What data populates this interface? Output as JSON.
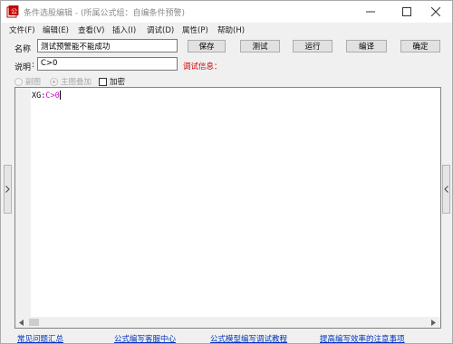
{
  "window": {
    "title": "条件选股编辑 - (所属公式组：自编条件预警)"
  },
  "menu": [
    {
      "label": "文件(F)"
    },
    {
      "label": "编辑(E)"
    },
    {
      "label": "查看(V)"
    },
    {
      "label": "插入(I)"
    },
    {
      "label": "调试(D)"
    },
    {
      "label": "属性(P)"
    },
    {
      "label": "帮助(H)"
    }
  ],
  "form": {
    "name_label": "名称",
    "name_value": "测试预警能不能成功",
    "desc_label": "说明",
    "desc_value": "C>0",
    "debug_label": "调试信息："
  },
  "buttons": {
    "save": "保存",
    "test": "测试",
    "run": "运行",
    "compile": "编译",
    "ok": "确定"
  },
  "options": {
    "subchart": "副图",
    "main_overlay": "主图叠加",
    "encrypt": "加密"
  },
  "editor": {
    "code_prefix": "XG:",
    "code_expr": "C>0"
  },
  "footer": {
    "faq": "常见问题汇总",
    "formula_service": "公式编写客服中心",
    "tutorial": "公式模型编写调试教程",
    "efficiency": "提高编写效率的注意事项"
  }
}
